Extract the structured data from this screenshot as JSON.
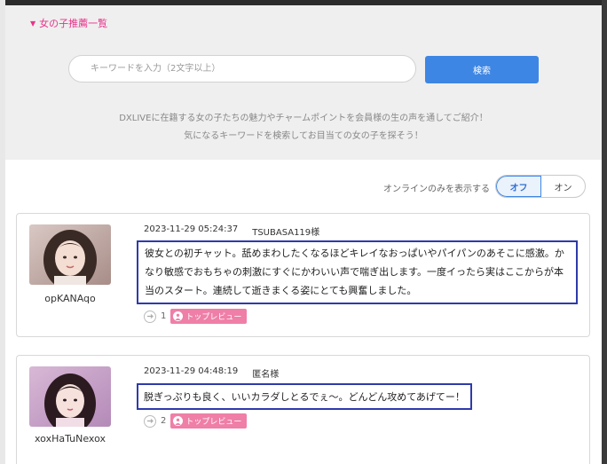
{
  "header": {
    "title": "女の子推薦一覧"
  },
  "search": {
    "placeholder": "キーワードを入力（2文字以上）",
    "button_label": "検索"
  },
  "intro": {
    "line1": "DXLIVEに在籍する女の子たちの魅力やチャームポイントを会員様の生の声を通してご紹介！",
    "line2": "気になるキーワードを検索してお目当ての女の子を探そう！"
  },
  "online_filter": {
    "label": "オンラインのみを表示する",
    "off_label": "オフ",
    "on_label": "オン",
    "selected": "オフ"
  },
  "reviews": [
    {
      "performer": "opKANAqo",
      "datetime": "2023-11-29 05:24:37",
      "reviewer": "TSUBASA119様",
      "text": "彼女との初チャット。舐めまわしたくなるほどキレイなおっぱいやパイパンのあそこに感激。かなり敏感でおもちゃの刺激にすぐにかわいい声で喘ぎ出します。一度イったら実はここからが本当のスタート。連続して逝きまくる姿にとても興奮しました。",
      "likes": "1",
      "badge": "トップレビュー"
    },
    {
      "performer": "xoxHaTuNexox",
      "datetime": "2023-11-29 04:48:19",
      "reviewer": "匿名様",
      "text": "脱ぎっぷりも良く、いいカラダしとるでぇ～。どんどん攻めてあげてー！",
      "likes": "2",
      "badge": "トップレビュー"
    }
  ],
  "colors": {
    "accent_pink": "#e8338b",
    "search_blue": "#3e86e3",
    "highlight_border": "#2e3baa",
    "badge_pink": "#ef7fa7"
  },
  "icons": {
    "header_caret": "triangle-down-icon",
    "like": "like-icon",
    "badge": "person-icon"
  }
}
